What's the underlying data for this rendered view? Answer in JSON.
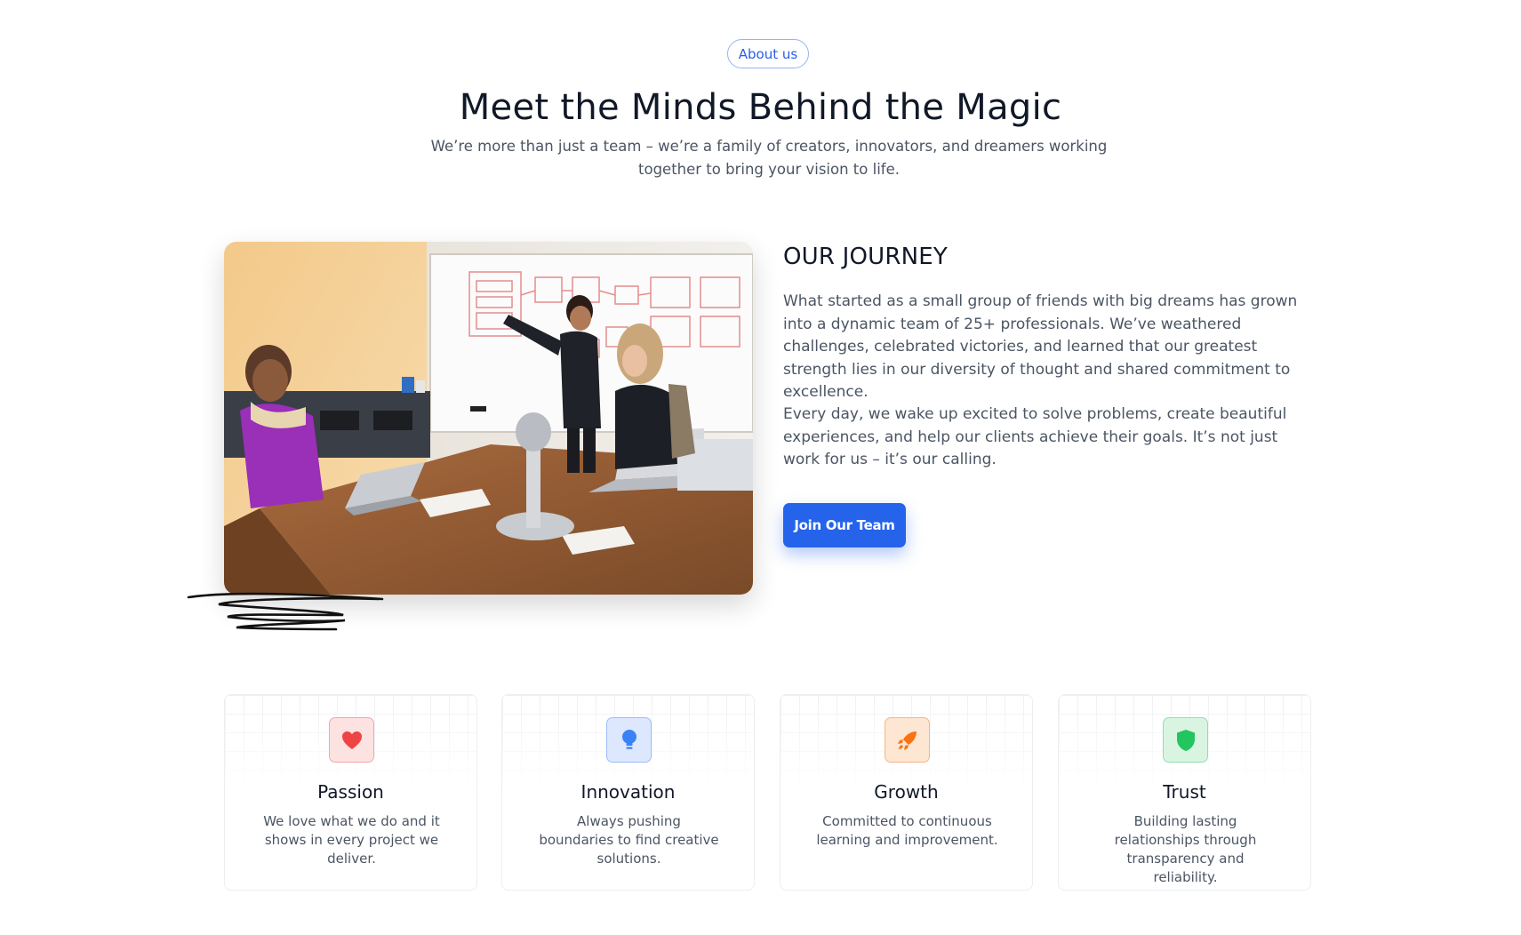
{
  "header": {
    "badge": "About us",
    "title": "Meet the Minds Behind the Magic",
    "subtitle": "We’re more than just a team – we’re a family of creators, innovators, and dreamers working together to bring your vision to life."
  },
  "journey": {
    "title": "OUR JOURNEY",
    "paragraph1": "What started as a small group of friends with big dreams has grown into a dynamic team of 25+ professionals. We’ve weathered challenges, celebrated victories, and learned that our greatest strength lies in our diversity of thought and shared commitment to excellence.",
    "paragraph2": "Every day, we wake up excited to solve problems, create beautiful experiences, and help our clients achieve their goals. It’s not just work for us – it’s our calling.",
    "cta": "Join Our Team"
  },
  "values": [
    {
      "title": "Passion",
      "description": "We love what we do and it shows in every project we deliver.",
      "icon": "heart-icon",
      "color": "#ef4444"
    },
    {
      "title": "Innovation",
      "description": "Always pushing boundaries to find creative solutions.",
      "icon": "lightbulb-icon",
      "color": "#3b82f6"
    },
    {
      "title": "Growth",
      "description": "Committed to continuous learning and improvement.",
      "icon": "rocket-icon",
      "color": "#f97316"
    },
    {
      "title": "Trust",
      "description": "Building lasting relationships through transparency and reliability.",
      "icon": "shield-icon",
      "color": "#22c55e"
    }
  ],
  "colors": {
    "accent": "#2563eb",
    "heading": "#111827",
    "body_text": "#4b5563"
  }
}
